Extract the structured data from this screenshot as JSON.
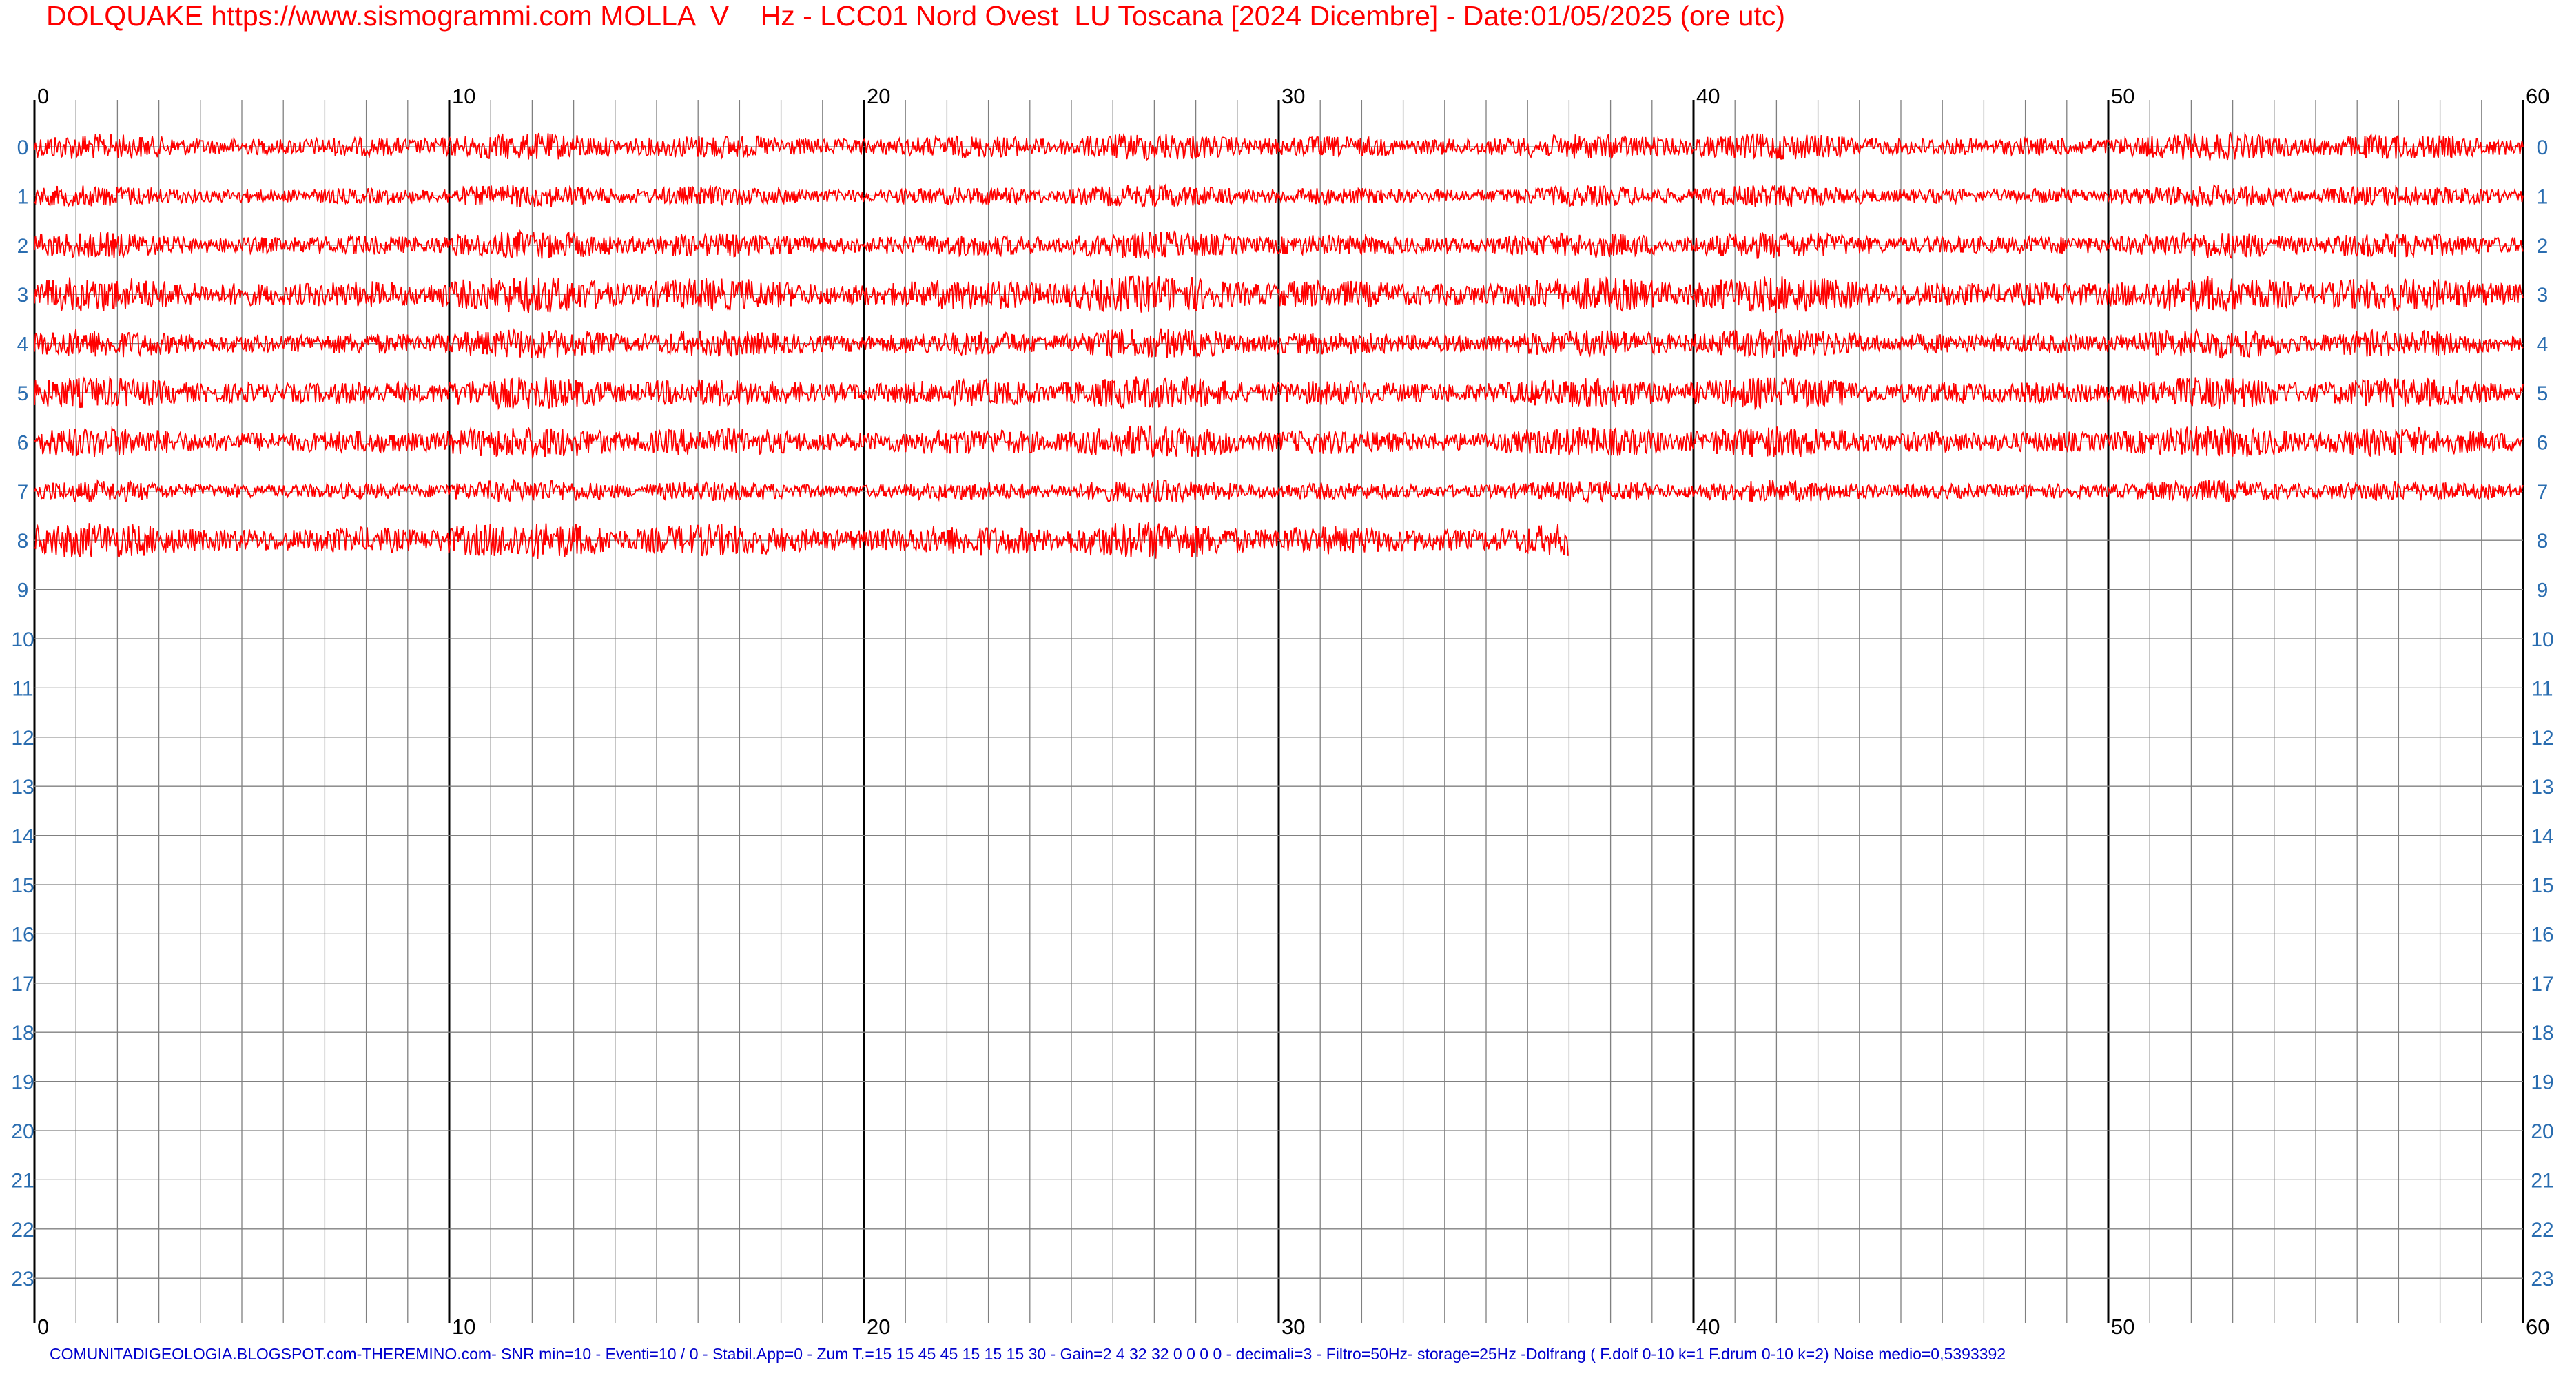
{
  "header": {
    "title": "DOLQUAKE https://www.sismogrammi.com MOLLA  V    Hz - LCC01 Nord Ovest  LU Toscana [2024 Dicembre] - Date:01/05/2025 (ore utc)"
  },
  "footer": {
    "text": "COMUNITADIGEOLOGIA.BLOGSPOT.com-THEREMINO.com- SNR min=10 - Eventi=10 / 0 - Stabil.App=0 - Zum T.=15 15 45 45 15 15 15 30 - Gain=2 4 32 32 0 0 0 0 - decimali=3 - Filtro=50Hz- storage=25Hz -Dolfrang ( F.dolf 0-10 k=1 F.drum 0-10 k=2) Noise medio=0,5393392"
  },
  "colors": {
    "trace": "#ff0000",
    "grid": "#808080",
    "major_grid": "#000000",
    "hour_labels": "#2a6db0",
    "title": "#ff0000",
    "footer": "#0000cc"
  },
  "chart_data": {
    "type": "line",
    "xlim": [
      0,
      60
    ],
    "x_ticks": [
      "0",
      "10",
      "20",
      "30",
      "40",
      "50",
      "60"
    ],
    "x_minor_step": 1,
    "y_rows": [
      "0",
      "1",
      "2",
      "3",
      "4",
      "5",
      "6",
      "7",
      "8",
      "9",
      "10",
      "11",
      "12",
      "13",
      "14",
      "15",
      "16",
      "17",
      "18",
      "19",
      "20",
      "21",
      "22",
      "23"
    ],
    "grid": true,
    "traces": [
      {
        "hour": 0,
        "end_minute": 60,
        "amplitude": 0.22
      },
      {
        "hour": 1,
        "end_minute": 60,
        "amplitude": 0.18
      },
      {
        "hour": 2,
        "end_minute": 60,
        "amplitude": 0.22
      },
      {
        "hour": 3,
        "end_minute": 60,
        "amplitude": 0.3
      },
      {
        "hour": 4,
        "end_minute": 60,
        "amplitude": 0.24
      },
      {
        "hour": 5,
        "end_minute": 60,
        "amplitude": 0.26
      },
      {
        "hour": 6,
        "end_minute": 60,
        "amplitude": 0.26
      },
      {
        "hour": 7,
        "end_minute": 60,
        "amplitude": 0.18
      },
      {
        "hour": 8,
        "end_minute": 37,
        "amplitude": 0.3
      }
    ]
  }
}
